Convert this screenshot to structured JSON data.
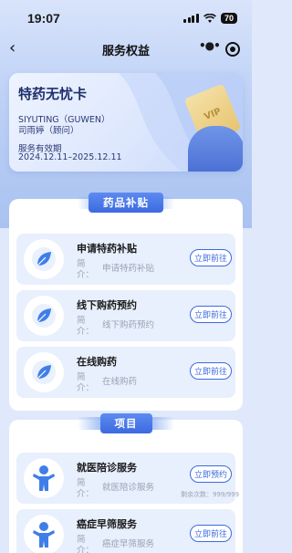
{
  "status": {
    "time": "19:07",
    "battery": "70"
  },
  "nav": {
    "title": "服务权益"
  },
  "card": {
    "title": "特药无忧卡",
    "name_en": "SIYUTING（GUWEN）",
    "name_cn": "司雨婷（顾问）",
    "valid_label": "服务有效期",
    "valid_range": "2024.12.11–2025.12.11",
    "badge": "VIP"
  },
  "section1": {
    "title": "药品补贴",
    "items": [
      {
        "name": "申请特药补贴",
        "intro_label": "简介：",
        "intro": "申请特药补贴",
        "button": "立即前往"
      },
      {
        "name": "线下购药预约",
        "intro_label": "简介：",
        "intro": "线下购药预约",
        "button": "立即前往"
      },
      {
        "name": "在线购药",
        "intro_label": "简介：",
        "intro": "在线购药",
        "button": "立即前往"
      }
    ]
  },
  "section2": {
    "title": "项目",
    "items": [
      {
        "name": "就医陪诊服务",
        "intro_label": "简介：",
        "intro": "就医陪诊服务",
        "button": "立即预约",
        "remain": "剩余次数：999/999"
      },
      {
        "name": "癌症早筛服务",
        "intro_label": "简介：",
        "intro": "癌症早筛服务",
        "button": "立即前往"
      }
    ]
  },
  "colors": {
    "accent": "#3c6ae0",
    "item_bg": "#e8effd",
    "page_bg": "#dfe9fb"
  }
}
